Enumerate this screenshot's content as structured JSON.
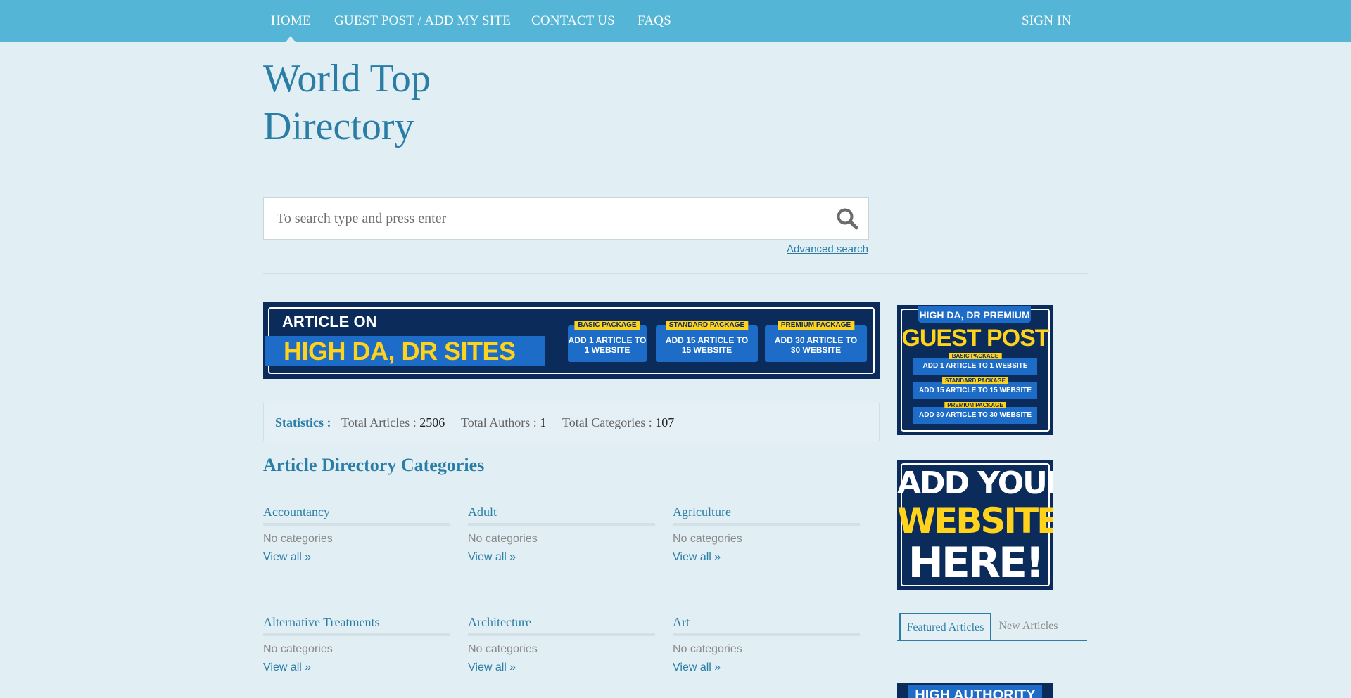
{
  "nav": {
    "home": "HOME",
    "guest_post": "GUEST POST / ADD MY SITE",
    "contact": "CONTACT US",
    "faqs": "FAQS",
    "sign_in": "SIGN IN"
  },
  "site": {
    "title_line1": "World Top",
    "title_line2": "Directory"
  },
  "search": {
    "placeholder": "To search type and press enter",
    "advanced_label": "Advanced search"
  },
  "banner": {
    "line1": "ARTICLE ON",
    "line2": "HIGH DA, DR SITES",
    "packages": [
      {
        "tag": "BASIC PACKAGE",
        "text_line1": "ADD 1 ARTICLE TO",
        "text_line2": "1 WEBSITE"
      },
      {
        "tag": "STANDARD PACKAGE",
        "text_line1": "ADD 15 ARTICLE TO",
        "text_line2": "15 WEBSITE"
      },
      {
        "tag": "PREMIUM PACKAGE",
        "text_line1": "ADD 30 ARTICLE TO",
        "text_line2": "30 WEBSITE"
      }
    ]
  },
  "stats": {
    "label": "Statistics :",
    "articles_label": "Total Articles :",
    "articles_value": "2506",
    "authors_label": "Total Authors :",
    "authors_value": "1",
    "categories_label": "Total Categories :",
    "categories_value": "107"
  },
  "categories": {
    "heading": "Article Directory Categories",
    "items": [
      {
        "name": "Accountancy",
        "sub": "No categories",
        "view": "View all »"
      },
      {
        "name": "Adult",
        "sub": "No categories",
        "view": "View all »"
      },
      {
        "name": "Agriculture",
        "sub": "No categories",
        "view": "View all »"
      },
      {
        "name": "Alternative Treatments",
        "sub": "No categories",
        "view": "View all »"
      },
      {
        "name": "Architecture",
        "sub": "No categories",
        "view": "View all »"
      },
      {
        "name": "Art",
        "sub": "No categories",
        "view": "View all »"
      }
    ]
  },
  "sidebar": {
    "ad1": {
      "tag": "HIGH DA, DR PREMIUM",
      "title": "GUEST POST",
      "packages": [
        {
          "tag": "BASIC PACKAGE",
          "text": "ADD 1 ARTICLE TO 1 WEBSITE"
        },
        {
          "tag": "STANDARD PACKAGE",
          "text": "ADD 15 ARTICLE TO 15 WEBSITE"
        },
        {
          "tag": "PREMIUM PACKAGE",
          "text": "ADD 30 ARTICLE TO 30 WEBSITE"
        }
      ]
    },
    "ad2": {
      "line1": "ADD YOUR",
      "line2": "WEBSITE",
      "line3": "HERE!"
    },
    "tabs": {
      "featured": "Featured Articles",
      "new": "New Articles"
    },
    "ad3": {
      "text": "HIGH AUTHORITY"
    }
  },
  "colors": {
    "nav_bg": "#55b5d6",
    "page_bg": "#e1eef3",
    "accent": "#2a7ea6",
    "ad_navy": "#0b2b5a",
    "ad_yellow": "#ffd21c",
    "ad_blue": "#1d6cc8"
  }
}
